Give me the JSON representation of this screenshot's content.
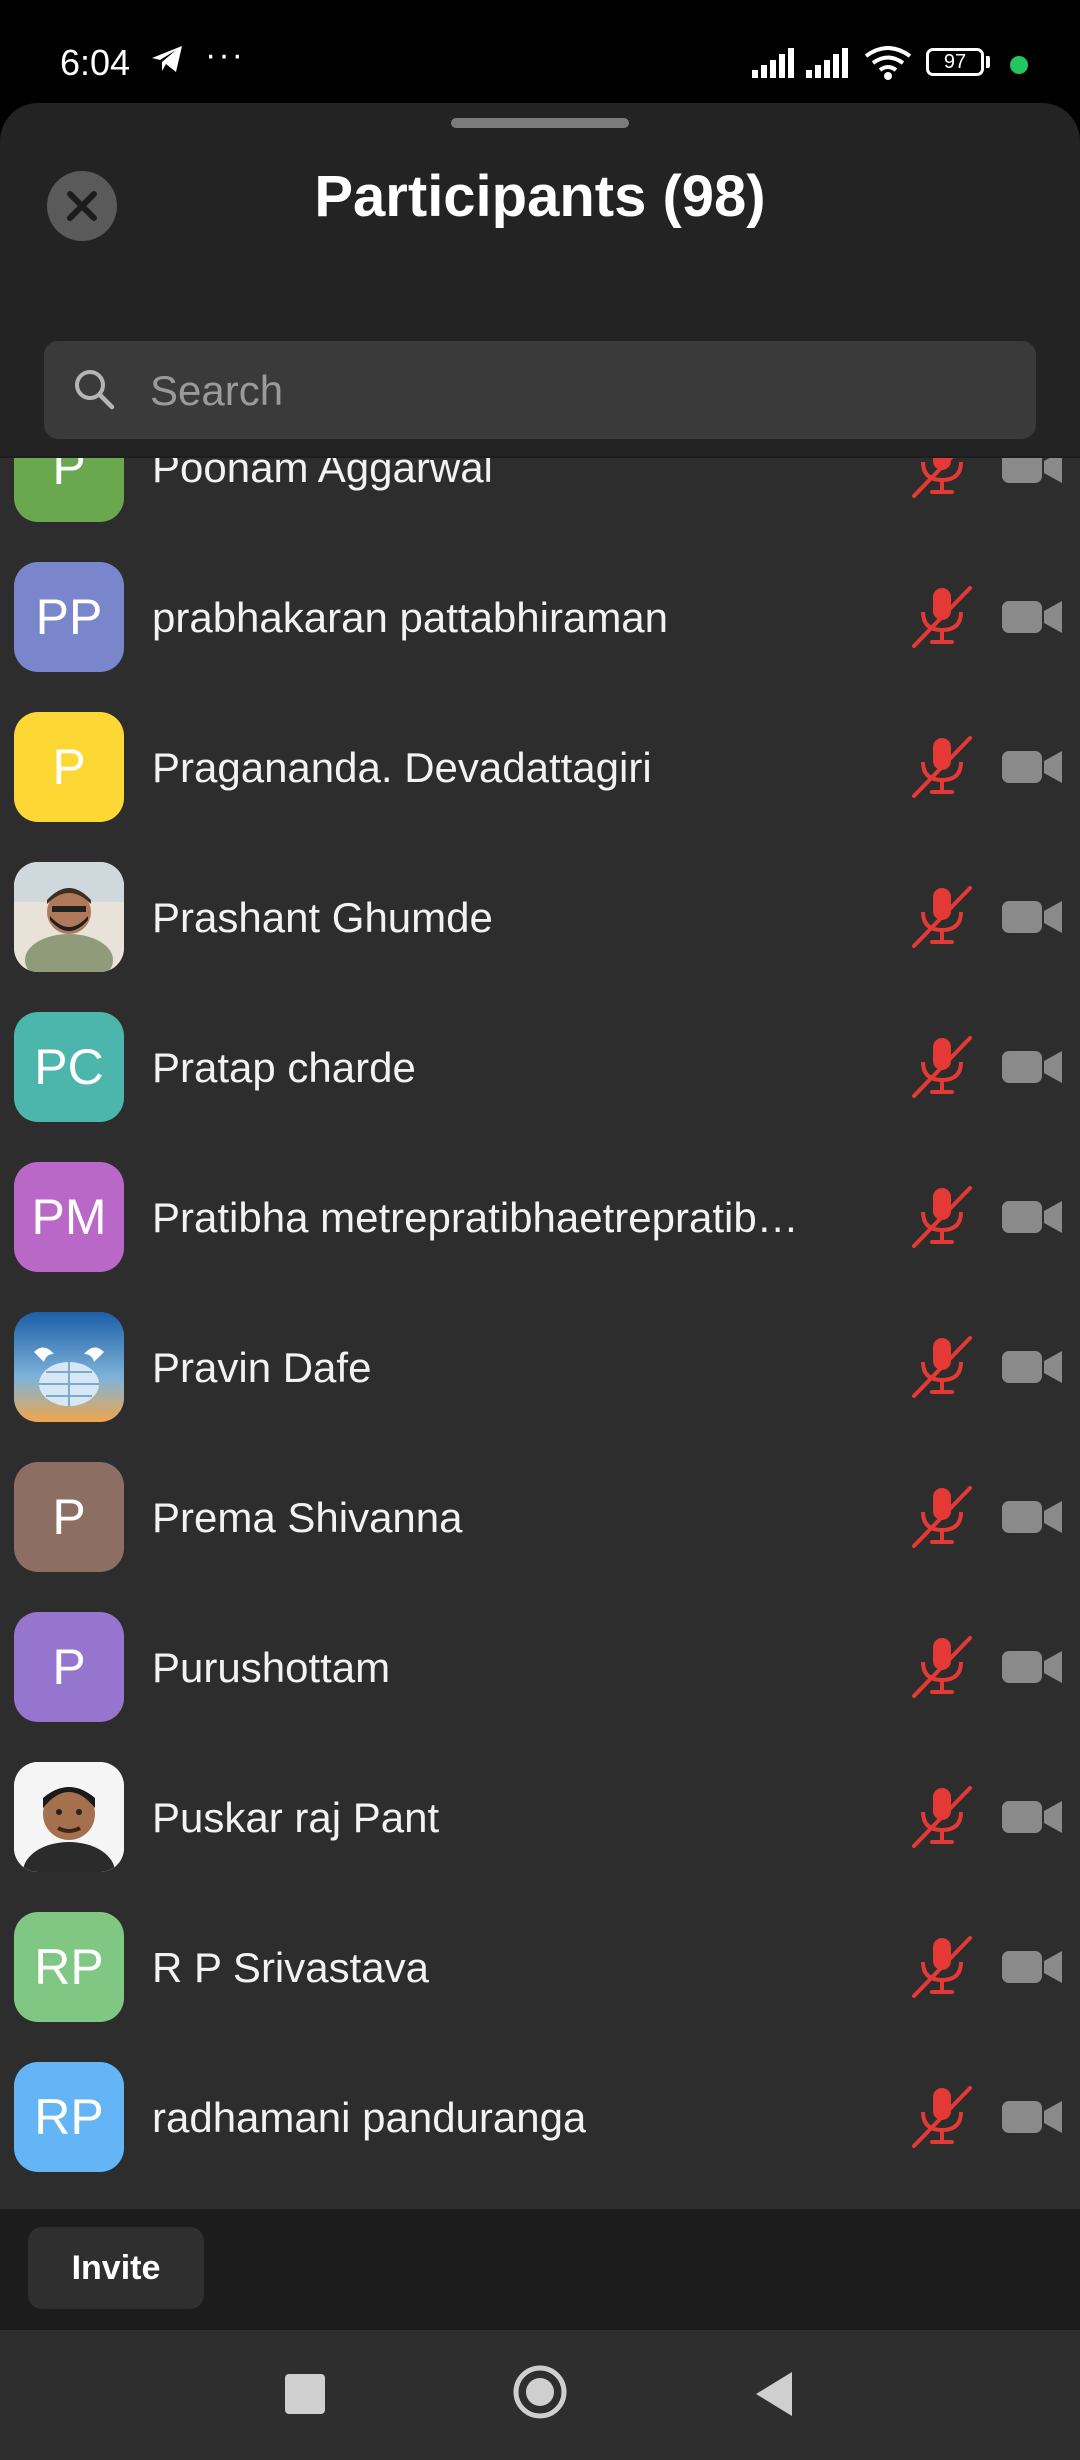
{
  "status_bar": {
    "time": "6:04",
    "battery": "97"
  },
  "header": {
    "title": "Participants (98)"
  },
  "search": {
    "placeholder": "Search"
  },
  "participants": [
    {
      "initials": "P",
      "name": "Poonam Aggarwal",
      "color": "#6aa84f",
      "avatar_type": "initials"
    },
    {
      "initials": "PP",
      "name": "prabhakaran pattabhiraman",
      "color": "#7986cb",
      "avatar_type": "initials"
    },
    {
      "initials": "P",
      "name": "Pragananda.   Devadattagiri",
      "color": "#fdd835",
      "avatar_type": "initials"
    },
    {
      "initials": "",
      "name": "Prashant Ghumde",
      "color": "#d9c3a8",
      "avatar_type": "photo-person-mask"
    },
    {
      "initials": "PC",
      "name": "Pratap charde",
      "color": "#4db6ac",
      "avatar_type": "initials"
    },
    {
      "initials": "PM",
      "name": "Pratibha metrepratibhaetrepratib…",
      "color": "#ba68c8",
      "avatar_type": "initials"
    },
    {
      "initials": "",
      "name": "Pravin Dafe",
      "color": "#2f6fb5",
      "avatar_type": "photo-globe-doves"
    },
    {
      "initials": "P",
      "name": "Prema Shivanna",
      "color": "#8d6e63",
      "avatar_type": "initials"
    },
    {
      "initials": "P",
      "name": "Purushottam",
      "color": "#9575cd",
      "avatar_type": "initials"
    },
    {
      "initials": "",
      "name": "Puskar raj Pant",
      "color": "#f2f2f2",
      "avatar_type": "photo-person"
    },
    {
      "initials": "RP",
      "name": "R P Srivastava",
      "color": "#81c784",
      "avatar_type": "initials"
    },
    {
      "initials": "RP",
      "name": "radhamani panduranga",
      "color": "#64b5f6",
      "avatar_type": "initials"
    }
  ],
  "icons": {
    "mic": "mic-off-icon",
    "video": "video-off-icon",
    "muted_color": "#e53935",
    "video_color": "#8a8a8a"
  },
  "footer": {
    "invite_label": "Invite"
  }
}
